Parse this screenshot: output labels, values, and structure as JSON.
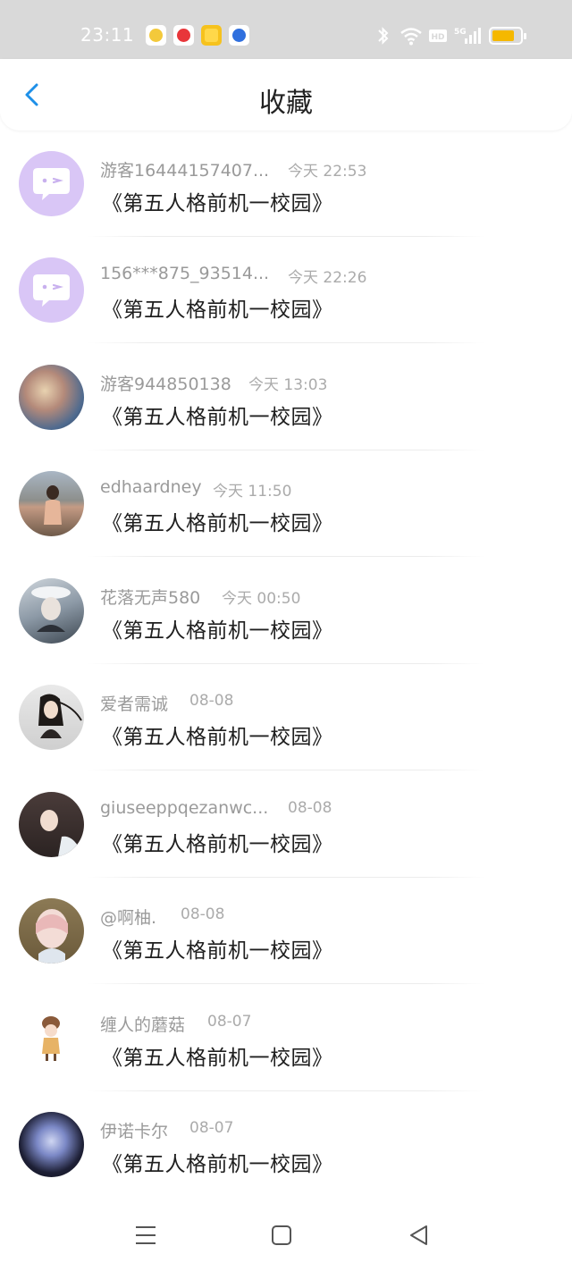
{
  "status_bar": {
    "time": "23:11",
    "icons": [
      "chat-notif-icon",
      "video-notif-icon",
      "note-notif-icon",
      "baidu-notif-icon"
    ],
    "right_icons": [
      "bluetooth-icon",
      "wifi-icon",
      "hd-icon",
      "signal-5g-icon",
      "battery-icon"
    ],
    "battery_color": "#f5b800"
  },
  "header": {
    "back_icon": "chevron-left-icon",
    "title": "收藏",
    "accent": "#1e90e8"
  },
  "items": [
    {
      "name": "游客16444157407...",
      "time": "今天 22:53",
      "work": "《第五人格前机一校园》",
      "avatar": "default-chat-avatar"
    },
    {
      "name": "156***875_93514...",
      "time": "今天 22:26",
      "work": "《第五人格前机一校园》",
      "avatar": "default-chat-avatar"
    },
    {
      "name": "游客944850138",
      "time": "今天 13:03",
      "work": "《第五人格前机一校园》",
      "avatar": "photo-avatar"
    },
    {
      "name": "edhaardney",
      "time": "今天 11:50",
      "work": "《第五人格前机一校园》",
      "avatar": "photo-avatar"
    },
    {
      "name": "花落无声580",
      "time": "今天 00:50",
      "work": "《第五人格前机一校园》",
      "avatar": "photo-avatar"
    },
    {
      "name": "爱者需诚",
      "time": "08-08",
      "work": "《第五人格前机一校园》",
      "avatar": "photo-avatar"
    },
    {
      "name": "giuseeppqezanwc...",
      "time": "08-08",
      "work": "《第五人格前机一校园》",
      "avatar": "photo-avatar"
    },
    {
      "name": "@啊柚.",
      "time": "08-08",
      "work": "《第五人格前机一校园》",
      "avatar": "photo-avatar"
    },
    {
      "name": "缠人的蘑菇",
      "time": "08-07",
      "work": "《第五人格前机一校园》",
      "avatar": "photo-avatar"
    },
    {
      "name": "伊诺卡尔",
      "time": "08-07",
      "work": "《第五人格前机一校园》",
      "avatar": "photo-avatar"
    }
  ],
  "nav": {
    "icons": [
      "menu-icon",
      "home-icon",
      "back-triangle-icon"
    ]
  }
}
